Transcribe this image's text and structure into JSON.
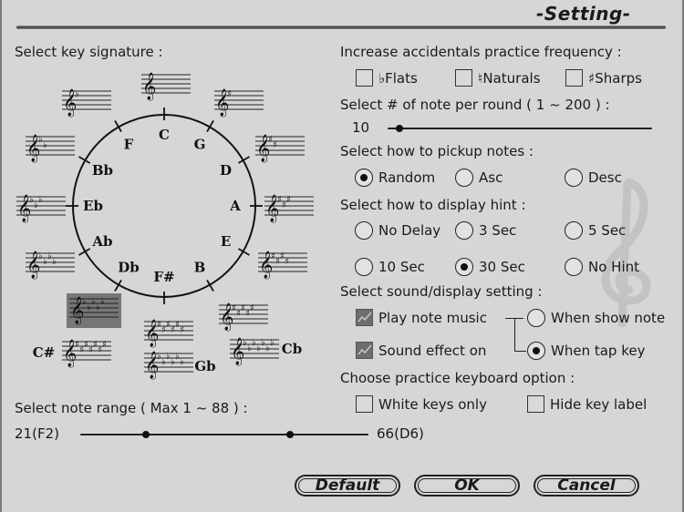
{
  "header": {
    "title": "-Setting-"
  },
  "key_signature": {
    "label": "Select key signature :",
    "keys": [
      {
        "name": "C",
        "accidentals": "",
        "count": 0
      },
      {
        "name": "G",
        "accidentals": "sharp",
        "count": 1
      },
      {
        "name": "D",
        "accidentals": "sharp",
        "count": 2
      },
      {
        "name": "A",
        "accidentals": "sharp",
        "count": 3
      },
      {
        "name": "E",
        "accidentals": "sharp",
        "count": 4
      },
      {
        "name": "B",
        "accidentals": "sharp",
        "count": 5
      },
      {
        "name": "F#",
        "accidentals": "sharp",
        "count": 6
      },
      {
        "name": "C#",
        "accidentals": "sharp",
        "count": 7
      },
      {
        "name": "F",
        "accidentals": "flat",
        "count": 1
      },
      {
        "name": "Bb",
        "accidentals": "flat",
        "count": 2
      },
      {
        "name": "Eb",
        "accidentals": "flat",
        "count": 3
      },
      {
        "name": "Ab",
        "accidentals": "flat",
        "count": 4
      },
      {
        "name": "Db",
        "accidentals": "flat",
        "count": 5
      },
      {
        "name": "Gb",
        "accidentals": "flat",
        "count": 6
      },
      {
        "name": "Cb",
        "accidentals": "flat",
        "count": 7
      }
    ],
    "selected": "Db"
  },
  "note_range": {
    "label": "Select note range ( Max 1 ~ 88 ) :",
    "min_label": "21(F2)",
    "max_label": "66(D6)",
    "low_fraction": 0.227,
    "high_fraction": 0.727
  },
  "accidentals": {
    "label": "Increase accidentals practice frequency :",
    "options": [
      {
        "symbol": "♭",
        "label": "Flats",
        "checked": false
      },
      {
        "symbol": "♮",
        "label": "Naturals",
        "checked": false
      },
      {
        "symbol": "♯",
        "label": "Sharps",
        "checked": false
      }
    ]
  },
  "notes_per_round": {
    "label": "Select # of note per round ( 1 ~ 200 ) :",
    "value": "10",
    "fraction": 0.045
  },
  "pickup": {
    "label": "Select how to pickup notes :",
    "options": [
      {
        "label": "Random",
        "selected": true
      },
      {
        "label": "Asc",
        "selected": false
      },
      {
        "label": "Desc",
        "selected": false
      }
    ]
  },
  "hint": {
    "label": "Select how to display hint :",
    "options": [
      {
        "label": "No Delay",
        "selected": false
      },
      {
        "label": "3 Sec",
        "selected": false
      },
      {
        "label": "5 Sec",
        "selected": false
      },
      {
        "label": "10 Sec",
        "selected": false
      },
      {
        "label": "30 Sec",
        "selected": true
      },
      {
        "label": "No Hint",
        "selected": false
      }
    ]
  },
  "sound": {
    "label": "Select sound/display setting :",
    "play_note_music": {
      "label": "Play note music",
      "checked": true
    },
    "sound_effect": {
      "label": "Sound effect on",
      "checked": true
    },
    "when_show_note": {
      "label": "When show note",
      "selected": false
    },
    "when_tap_key": {
      "label": "When tap key",
      "selected": true
    }
  },
  "keyboard": {
    "label": "Choose practice keyboard option :",
    "white_keys_only": {
      "label": "White keys only",
      "checked": false
    },
    "hide_key_label": {
      "label": "Hide key label",
      "checked": false
    }
  },
  "buttons": {
    "default": "Default",
    "ok": "OK",
    "cancel": "Cancel"
  }
}
